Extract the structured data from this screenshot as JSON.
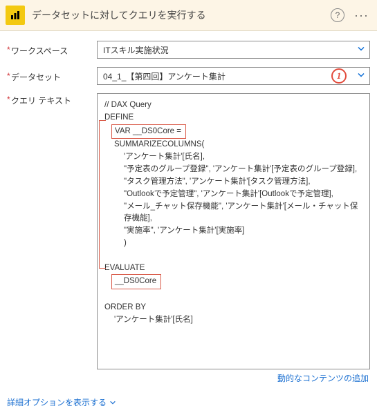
{
  "header": {
    "title": "データセットに対してクエリを実行する"
  },
  "labels": {
    "workspace": "ワークスペース",
    "dataset": "データセット",
    "query": "クエリ テキスト"
  },
  "workspace": {
    "value": "ITスキル実施状況"
  },
  "dataset": {
    "value": "04_1_【第四回】アンケート集計"
  },
  "callout1": "1",
  "q": {
    "l0": "// DAX Query",
    "l1": "DEFINE",
    "l2": "VAR __DS0Core =",
    "l3": "SUMMARIZECOLUMNS(",
    "l4": "'アンケート集計'[氏名],",
    "l5": "\"予定表のグループ登録\", 'アンケート集計'[予定表のグループ登録],",
    "l6": "\"タスク管理方法\", 'アンケート集計'[タスク管理方法],",
    "l7": "\"Outlookで予定管理\", 'アンケート集計'[Outlookで予定管理],",
    "l8": "\"メール_チャット保存機能\", 'アンケート集計'[メール・チャット保存機能],",
    "l9": "\"実施率\", 'アンケート集計'[実施率]",
    "l10": ")",
    "l11": "EVALUATE",
    "l12": "__DS0Core",
    "l13": "ORDER BY",
    "l14": "'アンケート集計'[氏名]"
  },
  "links": {
    "dynamic": "動的なコンテンツの追加",
    "advanced": "詳細オプションを表示する"
  }
}
